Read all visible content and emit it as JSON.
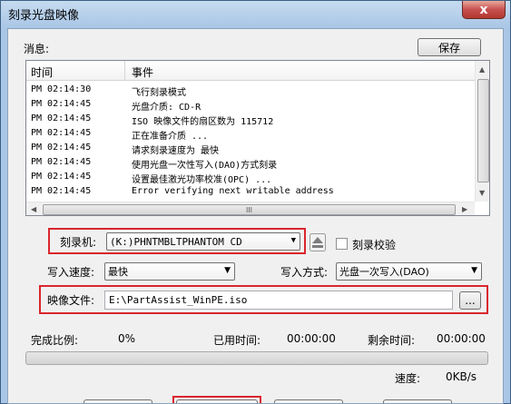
{
  "window": {
    "title": "刻录光盘映像",
    "close_symbol": "x"
  },
  "messages": {
    "label": "消息:",
    "save_button": "保存",
    "columns": [
      "时间",
      "事件"
    ],
    "rows": [
      {
        "time": "PM 02:14:30",
        "event": "飞行刻录模式"
      },
      {
        "time": "PM 02:14:45",
        "event": "光盘介质: CD-R"
      },
      {
        "time": "PM 02:14:45",
        "event": "ISO 映像文件的扇区数为 115712"
      },
      {
        "time": "PM 02:14:45",
        "event": "正在准备介质 ..."
      },
      {
        "time": "PM 02:14:45",
        "event": "请求刻录速度为 最快"
      },
      {
        "time": "PM 02:14:45",
        "event": "使用光盘一次性写入(DAO)方式刻录"
      },
      {
        "time": "PM 02:14:45",
        "event": "设置最佳激光功率校准(OPC) ..."
      },
      {
        "time": "PM 02:14:45",
        "event": "Error verifying next writable address"
      }
    ],
    "hscroll_grip": "III"
  },
  "burner": {
    "label": "刻录机:",
    "value": "(K:)PHNTMBLTPHANTOM CD",
    "verify_label": "刻录校验",
    "verify_checked": false
  },
  "write_speed": {
    "label": "写入速度:",
    "value": "最快"
  },
  "write_mode": {
    "label": "写入方式:",
    "value": "光盘一次写入(DAO)"
  },
  "image_file": {
    "label": "映像文件:",
    "value": "E:\\PartAssist_WinPE.iso",
    "browse_label": "..."
  },
  "status": {
    "complete_label": "完成比例:",
    "complete_value": "0%",
    "progress_percent": 0,
    "elapsed_label": "已用时间:",
    "elapsed_value": "00:00:00",
    "remaining_label": "剩余时间:",
    "remaining_value": "00:00:00",
    "speed_label": "速度:",
    "speed_value": "0KB/s"
  },
  "colors": {
    "highlight_border": "#d9262c",
    "title_bar": "#a9c6e6"
  }
}
